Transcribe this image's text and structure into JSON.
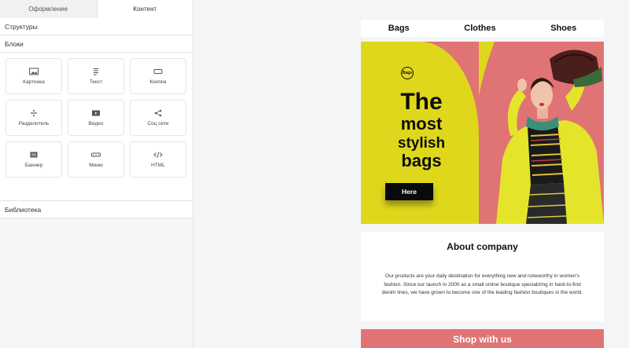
{
  "editor": {
    "tabs": [
      {
        "label": "Оформление",
        "active": false
      },
      {
        "label": "Контент",
        "active": true
      }
    ],
    "sections": {
      "structures": "Структуры",
      "blocks": "Блоки",
      "library": "Библиотека"
    },
    "blocks": [
      {
        "label": "Картинка",
        "icon": "image-icon"
      },
      {
        "label": "Текст",
        "icon": "text-icon"
      },
      {
        "label": "Кнопка",
        "icon": "button-icon"
      },
      {
        "label": "Разделитель",
        "icon": "divider-icon"
      },
      {
        "label": "Видео",
        "icon": "video-icon"
      },
      {
        "label": "Соц сети",
        "icon": "share-icon"
      },
      {
        "label": "Баннер",
        "icon": "banner-icon"
      },
      {
        "label": "Меню",
        "icon": "menu-icon"
      },
      {
        "label": "HTML",
        "icon": "code-icon"
      }
    ]
  },
  "email": {
    "nav": [
      "Bags",
      "Clothes",
      "Shoes"
    ],
    "hero": {
      "logo": "Bags",
      "title_lines": [
        "The",
        "most",
        "stylish",
        "bags"
      ],
      "button": "Here",
      "colors": {
        "yellow": "#dfd71c",
        "pink": "#e07474"
      }
    },
    "about": {
      "title": "About company",
      "text": "Our products are your daily destination for everything new and noteworthy in women's fashion. Since our launch in 2000 as a small online boutique specializing in hard-to-find denim lines, we have grown to become one of the leading fashion boutiques in the world."
    },
    "shop_banner": "Shop with us"
  }
}
